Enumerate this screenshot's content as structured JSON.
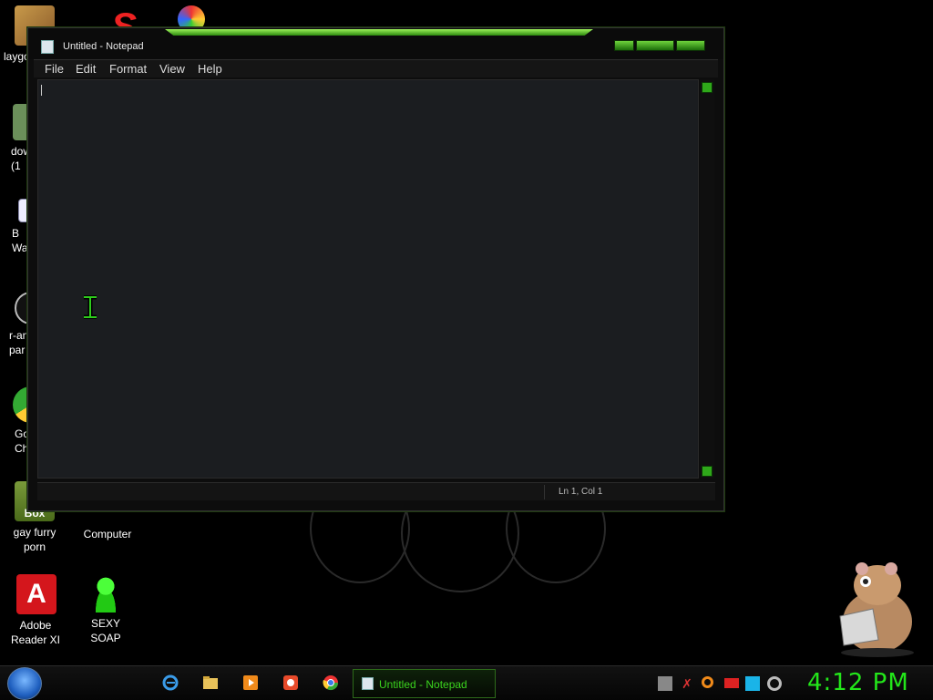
{
  "desktop": {
    "icons": [
      {
        "label": "laygo"
      },
      {
        "label": "dow\n(1"
      },
      {
        "label": "B\nWa"
      },
      {
        "label": "r-an\npar"
      },
      {
        "label": "Go\nCh"
      },
      {
        "label": "gay furry porn"
      },
      {
        "label": "Computer"
      },
      {
        "label": "Adobe Reader XI"
      },
      {
        "label": "SEXY SOAP"
      }
    ]
  },
  "notepad": {
    "title": "Untitled - Notepad",
    "menu": [
      "File",
      "Edit",
      "Format",
      "View",
      "Help"
    ],
    "content": "",
    "status_position": "Ln 1, Col 1"
  },
  "taskbar": {
    "pinned": [
      "internet-explorer-icon",
      "file-explorer-icon",
      "media-player-icon",
      "app-icon",
      "chrome-icon"
    ],
    "active_task": "Untitled - Notepad",
    "tray": [
      "tray-app-icon",
      "tray-tool-icon",
      "tray-search-icon",
      "tray-flag-icon",
      "tray-network-icon",
      "tray-volume-icon"
    ],
    "clock": "4:12 PM"
  },
  "colors": {
    "accent_green": "#23e61a",
    "window_bg": "#1b1d20",
    "desktop_bg": "#000000"
  }
}
